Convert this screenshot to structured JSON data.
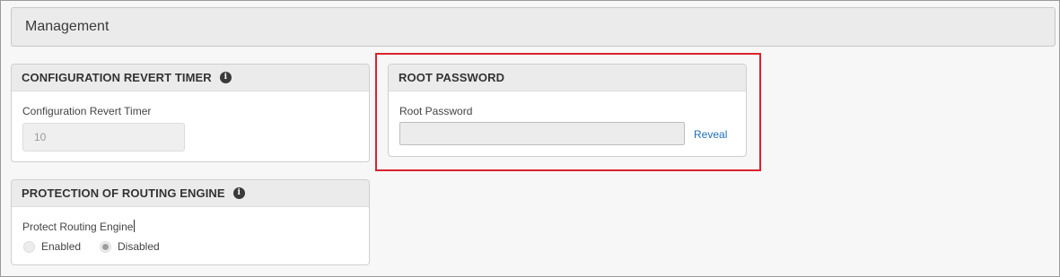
{
  "section": {
    "title": "Management"
  },
  "revert_timer": {
    "title": "CONFIGURATION REVERT TIMER",
    "field_label": "Configuration Revert Timer",
    "value": "10"
  },
  "routing_engine": {
    "title": "PROTECTION OF ROUTING ENGINE",
    "field_label": "Protect Routing Engine",
    "options": [
      {
        "label": "Enabled",
        "selected": false
      },
      {
        "label": "Disabled",
        "selected": true
      }
    ]
  },
  "root_password": {
    "title": "ROOT PASSWORD",
    "field_label": "Root Password",
    "value": "",
    "reveal_label": "Reveal"
  },
  "colors": {
    "highlight": "#d9232d",
    "link": "#1f6fb5"
  }
}
